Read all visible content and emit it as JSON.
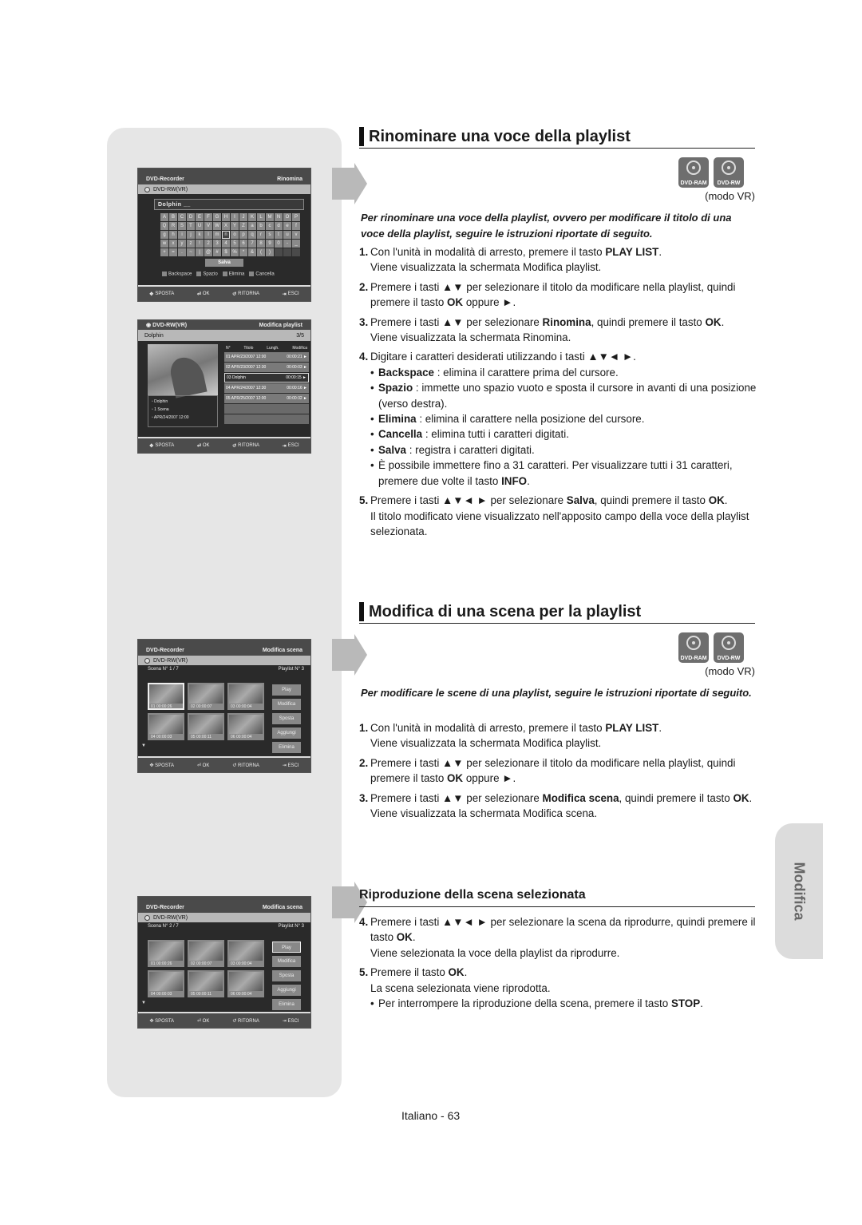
{
  "page": {
    "footer": "Italiano - 63",
    "side_tab": "Modifica"
  },
  "osd_common": {
    "sposta": "SPOSTA",
    "ok": "OK",
    "ritorna": "RITORNA",
    "esci": "ESCI",
    "disc": "DVD-RW(VR)",
    "recorder": "DVD-Recorder"
  },
  "osd_rename": {
    "mode": "Rinomina",
    "name_value": "Dolphin __",
    "keys": [
      "A",
      "B",
      "C",
      "D",
      "E",
      "F",
      "G",
      "H",
      "I",
      "J",
      "K",
      "L",
      "M",
      "N",
      "O",
      "P",
      "Q",
      "R",
      "S",
      "T",
      "U",
      "V",
      "W",
      "X",
      "Y",
      "Z",
      "a",
      "b",
      "c",
      "d",
      "e",
      "f",
      "g",
      "h",
      "i",
      "j",
      "k",
      "l",
      "m",
      "n",
      "o",
      "p",
      "q",
      "r",
      "s",
      "t",
      "u",
      "v",
      "w",
      "x",
      "y",
      "z",
      "!",
      "2",
      "3",
      "4",
      "5",
      "6",
      "7",
      "8",
      "9",
      "0",
      "-",
      "_",
      "+",
      "=",
      ".",
      "~",
      "|",
      "@",
      "#",
      "$",
      "%",
      "*",
      "&",
      "(",
      ")",
      "",
      "",
      ""
    ],
    "selected_key": "n",
    "salva": "Salva",
    "legend": [
      "Backspace",
      "Spazio",
      "Elimina",
      "Cancella"
    ]
  },
  "osd_playlist": {
    "mode": "Modifica playlist",
    "name": "Dolphin",
    "counter": "3/5",
    "headers": [
      "N°",
      "Titolo",
      "Lungh.",
      "Modifica"
    ],
    "rows": [
      {
        "text": "01 APR/23/2007 12:00",
        "len": "00:00:21"
      },
      {
        "text": "02 APR/23/2007 12:30",
        "len": "00:00:03"
      },
      {
        "text": "03 Dolphin",
        "len": "00:00:15",
        "selected": true
      },
      {
        "text": "04 APR/24/2007 12:30",
        "len": "00:00:16"
      },
      {
        "text": "05 APR/25/2007 12:00",
        "len": "00:00:32"
      }
    ],
    "info": [
      "Dolphin",
      "1 Scena",
      "APR/24/2007 12:00"
    ]
  },
  "osd_scene1": {
    "mode": "Modifica scena",
    "scene_label": "Scena N°",
    "scene_value": "1 / 7",
    "playlist_label": "Playlist N°",
    "playlist_value": "3",
    "cells": [
      "01  00:00:26",
      "02  00:00:07",
      "03  00:00:04",
      "04  00:00:03",
      "05  00:00:11",
      "06  00:00:04"
    ],
    "buttons": [
      "Play",
      "Modifica",
      "Sposta",
      "Aggiungi",
      "Elimina"
    ]
  },
  "osd_scene2": {
    "mode": "Modifica scena",
    "scene_label": "Scena N°",
    "scene_value": "2 / 7",
    "playlist_label": "Playlist N°",
    "playlist_value": "3",
    "cells": [
      "01  00:00:26",
      "02  00:00:07",
      "03  00:00:04",
      "04  00:00:03",
      "05  00:00:11",
      "06  00:00:04"
    ],
    "buttons": [
      "Play",
      "Modifica",
      "Sposta",
      "Aggiungi",
      "Elimina"
    ]
  },
  "badges": [
    "DVD-RAM",
    "DVD-RW"
  ],
  "modo": "(modo VR)",
  "section1": {
    "title": "Rinominare una voce della playlist",
    "intro": "Per rinominare una voce della playlist, ovvero per modificare il titolo di una voce della playlist, seguire le istruzioni riportate di seguito."
  },
  "section2": {
    "title": "Modifica di una scena per la playlist",
    "intro": "Per modificare le scene di una playlist, seguire le istruzioni riportate di seguito."
  },
  "section3": {
    "title": "Riproduzione della scena selezionata"
  }
}
